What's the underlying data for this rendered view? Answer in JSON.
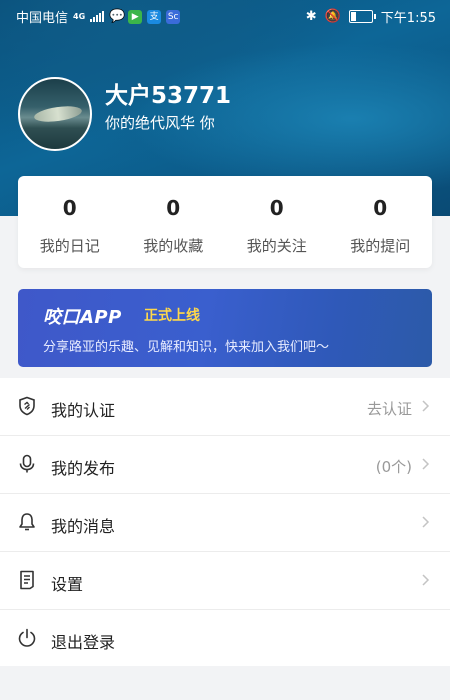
{
  "status_bar": {
    "carrier": "中国电信",
    "network": "4G",
    "time": "下午1:55"
  },
  "profile": {
    "username": "大户53771",
    "signature": "你的绝代风华 你"
  },
  "stats": [
    {
      "count": "0",
      "label": "我的日记"
    },
    {
      "count": "0",
      "label": "我的收藏"
    },
    {
      "count": "0",
      "label": "我的关注"
    },
    {
      "count": "0",
      "label": "我的提问"
    }
  ],
  "banner": {
    "title": "咬口APP",
    "tag": "正式上线",
    "text": "分享路亚的乐趣、见解和知识，快来加入我们吧～"
  },
  "menu": [
    {
      "label": "我的认证",
      "value": "去认证",
      "icon": "shield-icon"
    },
    {
      "label": "我的发布",
      "value": "(0个)",
      "icon": "microphone-icon"
    },
    {
      "label": "我的消息",
      "value": "",
      "icon": "bell-icon"
    },
    {
      "label": "设置",
      "value": "",
      "icon": "document-icon"
    },
    {
      "label": "退出登录",
      "value": "",
      "icon": "power-icon"
    }
  ],
  "colors": {
    "hero": "#0d6697",
    "banner": "#3a5fce",
    "banner_tag": "#ffd84a"
  }
}
